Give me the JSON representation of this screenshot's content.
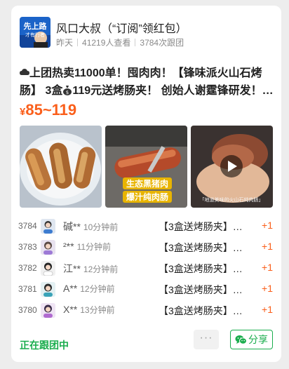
{
  "header": {
    "avatar_text_line1": "先上路",
    "avatar_text_line2": "才有行者",
    "shop_name": "风口大叔（“订阅”领红包）",
    "time_ago": "昨天",
    "views": "41219人查看",
    "group_count": "3784次跟团"
  },
  "product": {
    "title_icon": "☁",
    "title_text": "上团热卖11000单！囤肉肉！【锋味派火山石烤肠】 3盒",
    "money_icon": "💰",
    "title_text2": "119元送烤肠夹！ 创始人谢霆锋研发！…",
    "price_currency": "¥",
    "price_range": "85~119",
    "photo2_caption_line1": "生态黑猪肉",
    "photo2_caption_line2": "爆汁纯肉肠",
    "photo3_caption": "「地道美味的火山石纯肉肠」"
  },
  "orders": [
    {
      "rank": "3784",
      "name": "碱**",
      "time": "10分钟前",
      "item": "【3盒送烤肠夹】…",
      "qty": "+1"
    },
    {
      "rank": "3783",
      "name": "²**",
      "time": "11分钟前",
      "item": "【3盒送烤肠夹】…",
      "qty": "+1"
    },
    {
      "rank": "3782",
      "name": "江**",
      "time": "12分钟前",
      "item": "【3盒送烤肠夹】…",
      "qty": "+1"
    },
    {
      "rank": "3781",
      "name": "A**",
      "time": "12分钟前",
      "item": "【3盒送烤肠夹】…",
      "qty": "+1"
    },
    {
      "rank": "3780",
      "name": "X**",
      "time": "13分钟前",
      "item": "【3盒送烤肠夹】…",
      "qty": "+1"
    }
  ],
  "footer": {
    "following_label": "正在跟团中",
    "more_label": "···",
    "share_label": "分享"
  },
  "colors": {
    "accent_orange": "#fa5f1b",
    "wechat_green": "#1aad4d"
  },
  "icons": {
    "cloud": "cloud-icon",
    "money_bag": "money-bag-icon",
    "play": "play-icon",
    "wechat": "wechat-icon",
    "more": "more-icon"
  }
}
